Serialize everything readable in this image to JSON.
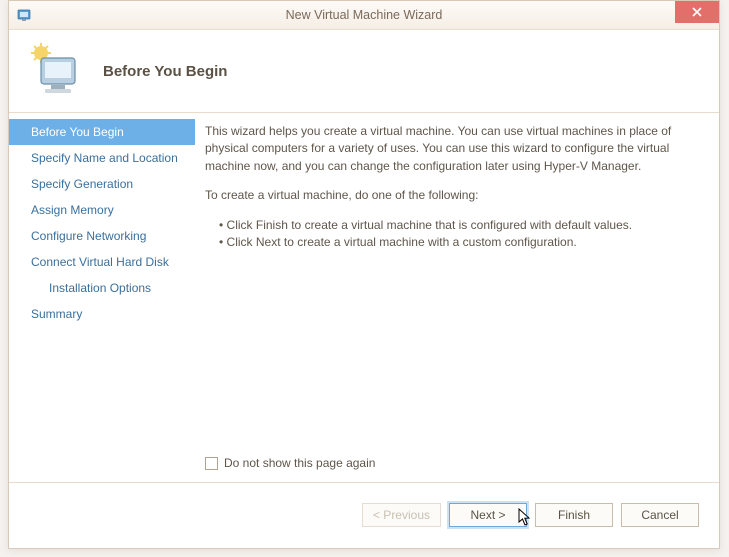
{
  "window": {
    "title": "New Virtual Machine Wizard"
  },
  "header": {
    "title": "Before You Begin"
  },
  "sidebar": {
    "items": [
      {
        "label": "Before You Begin",
        "selected": true,
        "sub": false
      },
      {
        "label": "Specify Name and Location",
        "selected": false,
        "sub": false
      },
      {
        "label": "Specify Generation",
        "selected": false,
        "sub": false
      },
      {
        "label": "Assign Memory",
        "selected": false,
        "sub": false
      },
      {
        "label": "Configure Networking",
        "selected": false,
        "sub": false
      },
      {
        "label": "Connect Virtual Hard Disk",
        "selected": false,
        "sub": false
      },
      {
        "label": "Installation Options",
        "selected": false,
        "sub": true
      },
      {
        "label": "Summary",
        "selected": false,
        "sub": false
      }
    ]
  },
  "content": {
    "intro": "This wizard helps you create a virtual machine. You can use virtual machines in place of physical computers for a variety of uses. You can use this wizard to configure the virtual machine now, and you can change the configuration later using Hyper-V Manager.",
    "instruction": "To create a virtual machine, do one of the following:",
    "bullets": [
      "Click Finish to create a virtual machine that is configured with default values.",
      "Click Next to create a virtual machine with a custom configuration."
    ],
    "checkbox_label": "Do not show this page again"
  },
  "footer": {
    "previous": "< Previous",
    "next": "Next >",
    "finish": "Finish",
    "cancel": "Cancel"
  }
}
